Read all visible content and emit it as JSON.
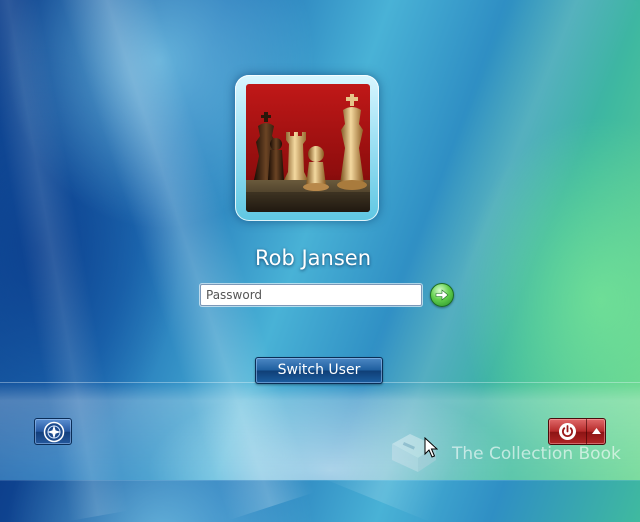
{
  "user": {
    "name": "Rob Jansen"
  },
  "login": {
    "password_placeholder": "Password"
  },
  "buttons": {
    "switch_user_label": "Switch User"
  },
  "watermark": {
    "text": "The Collection Book"
  },
  "icons": {
    "avatar": "chess-pieces-picture",
    "submit": "arrow-right-icon",
    "ease_of_access": "ease-of-access-icon",
    "power": "power-icon",
    "power_options": "caret-up-icon",
    "cursor": "mouse-pointer-icon",
    "watermark": "book-icon"
  },
  "colors": {
    "go_button": "#4bbf3c",
    "switch_user_button": "#1f5f9f",
    "power_button": "#b52a2a",
    "ease_button": "#2659a3"
  }
}
